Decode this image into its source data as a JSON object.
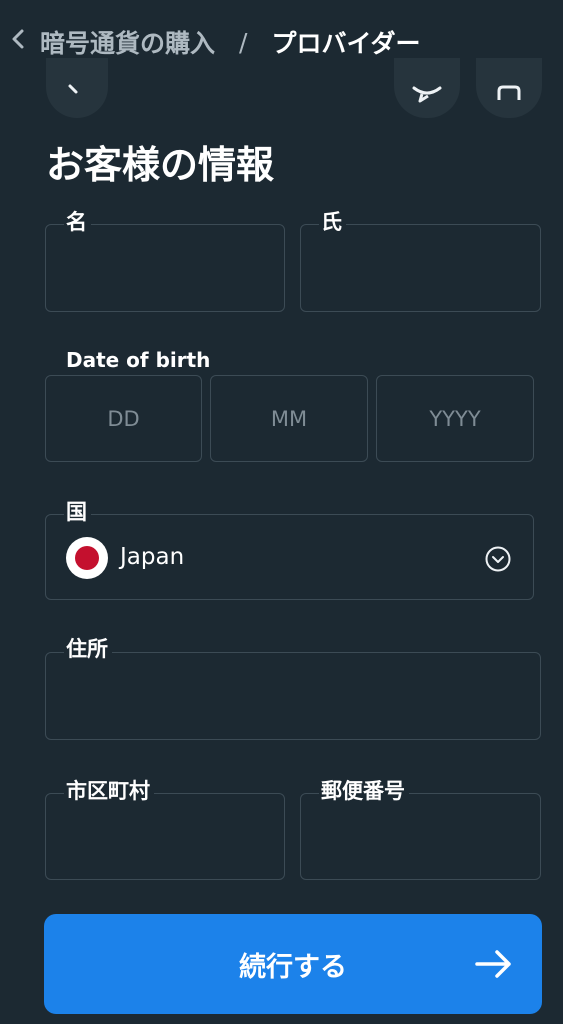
{
  "breadcrumb": {
    "back_icon": "chevron-left-icon",
    "parent": "暗号通貨の購入",
    "separator": "/",
    "current": "プロバイダー"
  },
  "section_title": "お客様の情報",
  "fields": {
    "first_name": {
      "label": "名",
      "value": ""
    },
    "last_name": {
      "label": "氏",
      "value": ""
    },
    "dob": {
      "label": "Date of birth",
      "day_placeholder": "DD",
      "month_placeholder": "MM",
      "year_placeholder": "YYYY"
    },
    "country": {
      "label": "国",
      "value": "Japan",
      "flag": "japan-flag-icon",
      "dropdown_icon": "chevron-down-circle-icon"
    },
    "address": {
      "label": "住所",
      "value": ""
    },
    "city": {
      "label": "市区町村",
      "value": ""
    },
    "postal_code": {
      "label": "郵便番号",
      "value": ""
    }
  },
  "submit": {
    "label": "続行する",
    "icon": "arrow-right-icon"
  },
  "colors": {
    "background": "#1c2932",
    "field_border": "#3c4b55",
    "accent": "#1c82ea",
    "flag_red": "#c4102e"
  }
}
